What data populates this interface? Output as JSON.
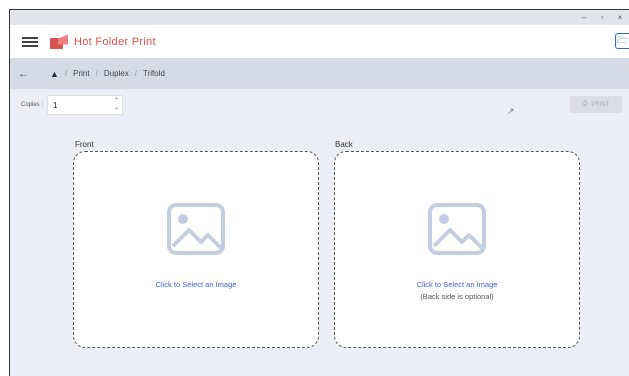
{
  "window": {
    "controls": {
      "minimize": "–",
      "maximize": "▫",
      "close": "×"
    }
  },
  "appbar": {
    "title": "Hot Folder Print",
    "menu_icon": "hamburger-icon",
    "logo_icon": "folder-print-logo",
    "folder_icon": "folder-icon"
  },
  "breadcrumb": {
    "back_icon": "arrow-left-icon",
    "home_icon": "home-icon",
    "separator": "/",
    "items": [
      "Print",
      "Duplex",
      "Trifold"
    ]
  },
  "copies": {
    "label": "Copies :",
    "value": "1"
  },
  "print_button": {
    "label": "PRINT",
    "icon": "printer-icon",
    "enabled": false
  },
  "front": {
    "label": "Front",
    "action": "Click to Select an Image",
    "note": ""
  },
  "back": {
    "label": "Back",
    "action": "Click to Select an Image",
    "note": "(Back side is optional)"
  },
  "colors": {
    "brand": "#d9534f",
    "link": "#3a67c9",
    "navbar_bg": "#d6d9e6",
    "content_bg": "#eceef5"
  }
}
